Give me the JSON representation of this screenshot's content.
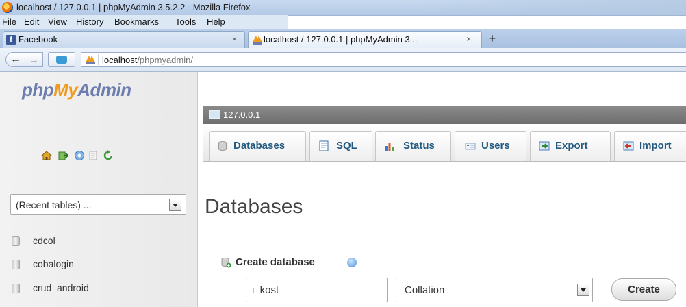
{
  "window": {
    "title": "localhost / 127.0.0.1 | phpMyAdmin 3.5.2.2 - Mozilla Firefox"
  },
  "menu": [
    "File",
    "Edit",
    "View",
    "History",
    "Bookmarks",
    "Tools",
    "Help"
  ],
  "tabs": [
    {
      "label": "Facebook",
      "close": "×",
      "icon": "facebook-icon"
    },
    {
      "label": "localhost / 127.0.0.1 | phpMyAdmin 3...",
      "close": "×",
      "icon": "phpmyadmin-icon"
    }
  ],
  "new_tab": "+",
  "nav": {
    "url_host": "localhost",
    "url_path": "/phpmyadmin/",
    "back": "back-arrow-icon",
    "forward": "forward-arrow-icon"
  },
  "sidebar": {
    "logo": {
      "php": "php",
      "my": "My",
      "admin": "Admin"
    },
    "icons": [
      "home-icon",
      "exit-icon",
      "query-window-icon",
      "documentation-icon",
      "reload-icon"
    ],
    "recent_tables": "(Recent tables) ...",
    "databases": [
      "cdcol",
      "cobalogin",
      "crud_android"
    ]
  },
  "server": {
    "label": "127.0.0.1"
  },
  "topmenu": [
    {
      "label": "Databases",
      "icon": "database-icon"
    },
    {
      "label": "SQL",
      "icon": "sql-icon"
    },
    {
      "label": "Status",
      "icon": "status-icon"
    },
    {
      "label": "Users",
      "icon": "users-icon"
    },
    {
      "label": "Export",
      "icon": "export-icon"
    },
    {
      "label": "Import",
      "icon": "import-icon"
    }
  ],
  "page": {
    "title": "Databases",
    "create_db_label": "Create database",
    "db_name_value": "i_kost",
    "collation_selected": "Collation",
    "create_button": "Create"
  },
  "colors": {
    "logo_blue": "#6d7db0",
    "logo_orange": "#f29a1c",
    "menu_link": "#235a81",
    "server_bar": "#7a7a7a"
  }
}
